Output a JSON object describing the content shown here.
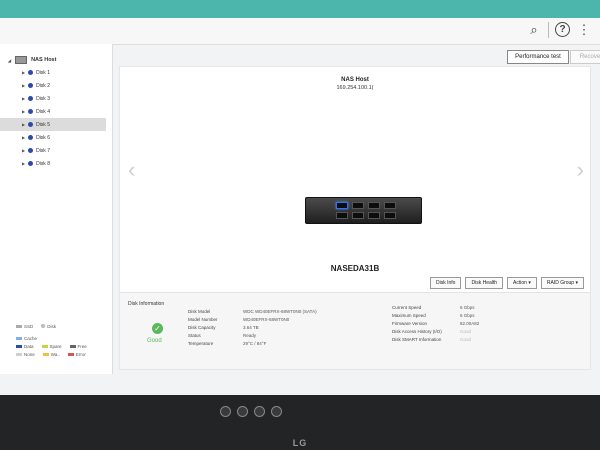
{
  "titlebar": {
    "search_icon": "search-icon",
    "help_icon": "help-icon",
    "more_icon": "more-icon"
  },
  "sidebar": {
    "root_label": "NAS Host",
    "items": [
      {
        "label": "Disk 1"
      },
      {
        "label": "Disk 2"
      },
      {
        "label": "Disk 3"
      },
      {
        "label": "Disk 4"
      },
      {
        "label": "Disk 5"
      },
      {
        "label": "Disk 6"
      },
      {
        "label": "Disk 7"
      },
      {
        "label": "Disk 8"
      }
    ],
    "selected_index": 4,
    "legend": {
      "ssd": "SSD",
      "disk": "Disk",
      "cache": "Cache",
      "data": "Data",
      "spare": "Spare",
      "free": "Free",
      "none": "None",
      "warning": "Wa..",
      "error": "Error"
    }
  },
  "toolbar": {
    "performance_test": "Performance test",
    "recover": "Recover"
  },
  "enclosure": {
    "title": "NAS Host",
    "ip": "169.254.100.1(",
    "model": "NASEDA31B"
  },
  "actions": {
    "disk_info": "Disk Info",
    "disk_health": "Disk Health",
    "action": "Action",
    "raid_group": "RAID Group"
  },
  "disk_information": {
    "heading": "Disk Information",
    "status_text": "Good",
    "left": [
      {
        "key": "Disk Model",
        "value": "WDC WD40EFRX-68WT0N0 (SATA)"
      },
      {
        "key": "Model Number",
        "value": "WD40EFRX-68WT0N0"
      },
      {
        "key": "Disk Capacity",
        "value": "3.64 TB"
      },
      {
        "key": "Status",
        "value": "Ready"
      },
      {
        "key": "Temperature",
        "value": "29°C / 84°F"
      }
    ],
    "right": [
      {
        "key": "Current Speed",
        "value": "6 Gbps"
      },
      {
        "key": "Maximum Speed",
        "value": "6 Gbps"
      },
      {
        "key": "Firmware Version",
        "value": "82.00A82"
      },
      {
        "key": "Disk Access History (I/O)",
        "value": "Good"
      },
      {
        "key": "Disk SMART Information",
        "value": "Good"
      }
    ]
  },
  "colors": {
    "accent": "#4db6ac",
    "good": "#5cb85c",
    "disk_dot": "#2c4aa8",
    "data": "#2c4aa8",
    "spare": "#c6d34a",
    "free": "#666666",
    "none": "#cfcfcf",
    "warning": "#f0c040",
    "error": "#d9534f"
  },
  "bezel": {
    "brand": "LG"
  }
}
